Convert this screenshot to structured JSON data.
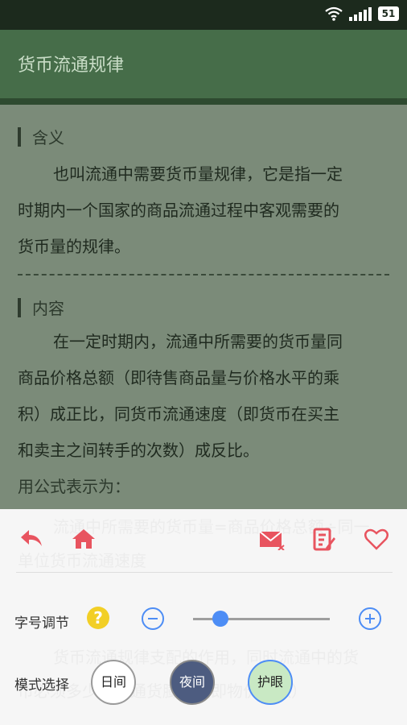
{
  "status_bar": {
    "battery": "51",
    "icons": [
      "wifi-icon",
      "signal-icon",
      "battery-icon"
    ]
  },
  "app_bar": {
    "title": "货币流通规律"
  },
  "article": {
    "sections": [
      {
        "title": "含义",
        "lines": [
          "也叫流通中需要货币量规律，它是指一定",
          "时期内一个国家的商品流通过程中客观需要的",
          "货币量的规律。"
        ]
      },
      {
        "title": "内容",
        "lines": [
          "在一定时期内，流通中所需要的货币量同",
          "商品价格总额（即待售商品量与价格水平的乘",
          "积）成正比，同货币流通速度（即货币在买主",
          "和卖主之间转手的次数）成反比。"
        ]
      }
    ],
    "formula_label": "用公式表示为："
  },
  "panel": {
    "ghost_lines": [
      "流通中所需要的货币量=商品价格总额÷同一",
      "单位货币流通速度",
      "货币流通规律支配的作用，同时流通中的货",
      "币必须多少，则通货膨胀（即物价上涨）"
    ],
    "toolbar": [
      "back-icon",
      "home-icon",
      "mail-icon",
      "notes-icon",
      "favorite-icon"
    ],
    "font_size_label": "字号调节",
    "font_size_level": 0.2,
    "mode_label": "模式选择",
    "modes": [
      "日间",
      "夜间",
      "护眼"
    ],
    "colors": {
      "icon_red": "#e8545f",
      "accent_blue": "#4d8df5",
      "help_yellow": "#f2cf26"
    }
  }
}
